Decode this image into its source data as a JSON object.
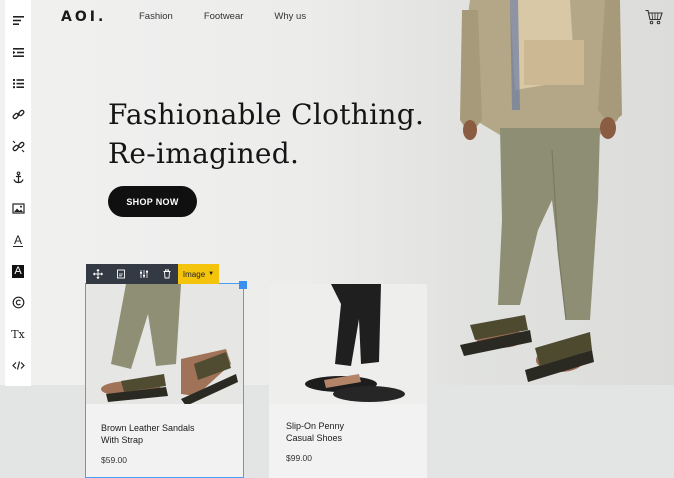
{
  "brand": {
    "logo": "AOI."
  },
  "nav": {
    "items": [
      "Fashion",
      "Footwear",
      "Why us"
    ]
  },
  "header": {
    "cart_icon": "cart-icon"
  },
  "hero": {
    "headline_line1": "Fashionable Clothing.",
    "headline_line2": "Re-imagined.",
    "cta_label": "SHOP NOW"
  },
  "editor_toolbar": {
    "tools": [
      "align-left-icon",
      "indent-icon",
      "list-icon",
      "link-icon",
      "unlink-icon",
      "anchor-icon",
      "image-icon",
      "text-color-icon",
      "text-highlight-icon",
      "copyright-icon",
      "clear-format-icon",
      "code-icon"
    ],
    "text_color_label": "A",
    "highlight_label": "A",
    "clear_format_label": "Tx"
  },
  "image_toolbar": {
    "tag_label": "Image",
    "tools": [
      "move-icon",
      "replace-icon",
      "settings-icon",
      "delete-icon"
    ],
    "accent": "#f4c40c",
    "selection_color": "#4c9df5"
  },
  "products": [
    {
      "name_line1": "Brown Leather Sandals",
      "name_line2": "With Strap",
      "price": "$59.00"
    },
    {
      "name_line1": "Slip-On Penny",
      "name_line2": "Casual Shoes",
      "price": "$99.00"
    }
  ]
}
